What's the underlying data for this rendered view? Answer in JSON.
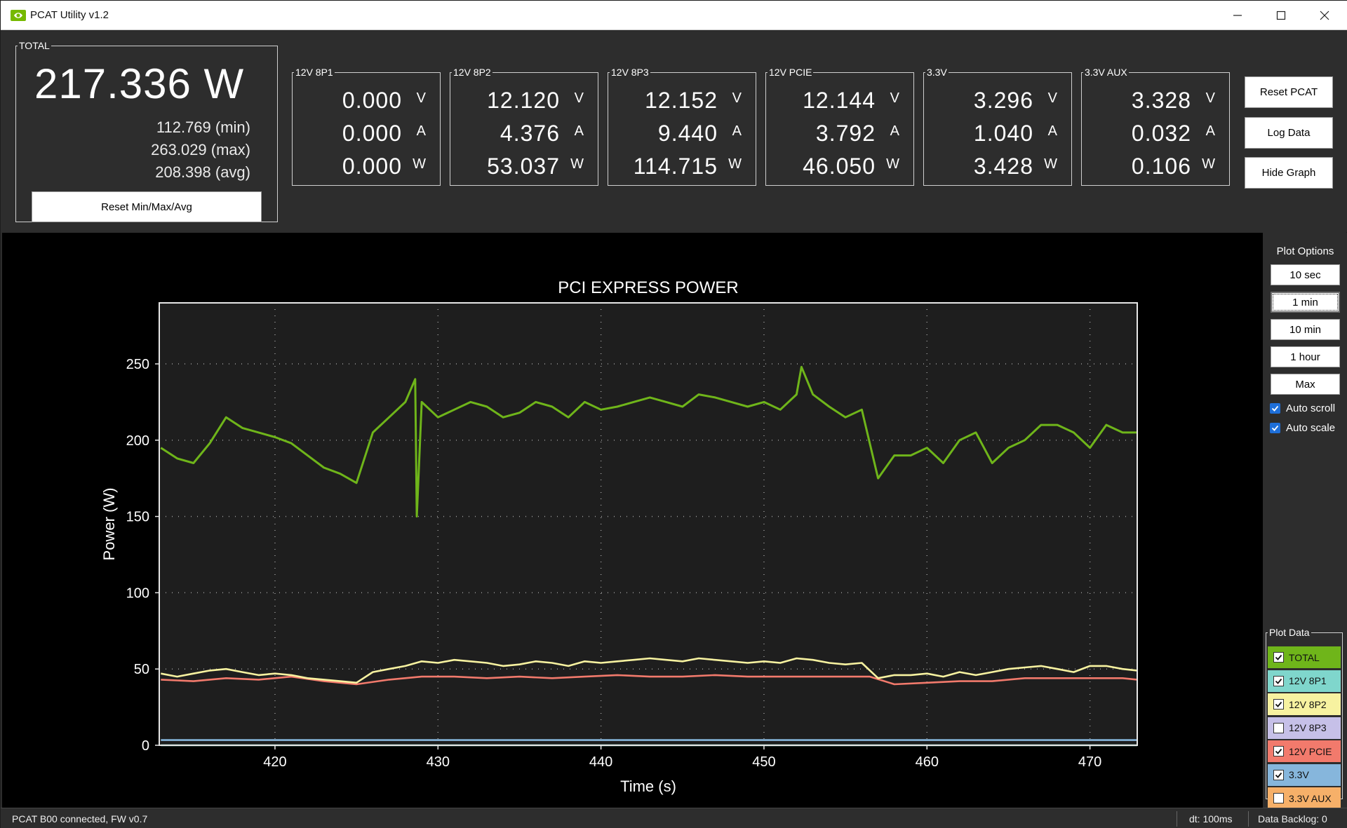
{
  "window": {
    "title": "PCAT Utility v1.2"
  },
  "total": {
    "legend": "TOTAL",
    "power": "217.336 W",
    "min": "112.769 (min)",
    "max": "263.029 (max)",
    "avg": "208.398 (avg)",
    "reset_label": "Reset Min/Max/Avg"
  },
  "rails": [
    {
      "name": "12V 8P1",
      "v": "0.000",
      "a": "0.000",
      "w": "0.000"
    },
    {
      "name": "12V 8P2",
      "v": "12.120",
      "a": "4.376",
      "w": "53.037"
    },
    {
      "name": "12V 8P3",
      "v": "12.152",
      "a": "9.440",
      "w": "114.715"
    },
    {
      "name": "12V PCIE",
      "v": "12.144",
      "a": "3.792",
      "w": "46.050"
    },
    {
      "name": "3.3V",
      "v": "3.296",
      "a": "1.040",
      "w": "3.428"
    },
    {
      "name": "3.3V AUX",
      "v": "3.328",
      "a": "0.032",
      "w": "0.106"
    }
  ],
  "units": {
    "v": "V",
    "a": "A",
    "w": "W"
  },
  "buttons": {
    "reset_pcat": "Reset PCAT",
    "log_data": "Log Data",
    "hide_graph": "Hide Graph"
  },
  "plot_options": {
    "header": "Plot Options",
    "ranges": [
      "10 sec",
      "1 min",
      "10 min",
      "1 hour",
      "Max"
    ],
    "active_range": "1 min",
    "auto_scroll": "Auto scroll",
    "auto_scale": "Auto scale",
    "auto_scroll_checked": true,
    "auto_scale_checked": true
  },
  "plot_data": {
    "header": "Plot Data",
    "items": [
      {
        "label": "TOTAL",
        "color": "#6fb51a",
        "checked": true
      },
      {
        "label": "12V 8P1",
        "color": "#7fd6cc",
        "checked": true
      },
      {
        "label": "12V 8P2",
        "color": "#f7f2a0",
        "checked": true
      },
      {
        "label": "12V 8P3",
        "color": "#c6c0e8",
        "checked": false
      },
      {
        "label": "12V PCIE",
        "color": "#f27a6c",
        "checked": true
      },
      {
        "label": "3.3V",
        "color": "#86b6dc",
        "checked": true
      },
      {
        "label": "3.3V AUX",
        "color": "#f6b069",
        "checked": false
      }
    ]
  },
  "chart_data": {
    "type": "line",
    "title": "PCI EXPRESS POWER",
    "xlabel": "Time (s)",
    "ylabel": "Power (W)",
    "xlim": [
      412.9,
      472.9
    ],
    "ylim": [
      0,
      290
    ],
    "xticks": [
      420,
      430,
      440,
      450,
      460,
      470
    ],
    "yticks": [
      0,
      50,
      100,
      150,
      200,
      250
    ],
    "grid": true,
    "series": [
      {
        "name": "TOTAL",
        "color": "#6fb51a",
        "x": [
          413,
          414,
          415,
          416,
          417,
          418,
          419,
          420,
          421,
          422,
          423,
          424,
          425,
          426,
          427,
          428,
          428.6,
          428.7,
          429,
          430,
          431,
          432,
          433,
          434,
          435,
          436,
          437,
          438,
          439,
          440,
          441,
          442,
          443,
          444,
          445,
          446,
          447,
          448,
          449,
          450,
          451,
          452,
          452.3,
          453,
          454,
          455,
          456,
          457,
          458,
          459,
          460,
          461,
          462,
          463,
          464,
          465,
          466,
          467,
          468,
          469,
          470,
          471,
          472,
          472.9
        ],
        "y": [
          195,
          188,
          185,
          198,
          215,
          208,
          205,
          202,
          198,
          190,
          182,
          178,
          172,
          205,
          215,
          225,
          240,
          150,
          225,
          215,
          220,
          225,
          222,
          215,
          218,
          225,
          222,
          215,
          225,
          220,
          222,
          225,
          228,
          225,
          222,
          230,
          228,
          225,
          222,
          225,
          220,
          230,
          248,
          230,
          222,
          215,
          220,
          175,
          190,
          190,
          195,
          185,
          200,
          205,
          185,
          195,
          200,
          210,
          210,
          205,
          195,
          210,
          205,
          205
        ]
      },
      {
        "name": "12V 8P2",
        "color": "#f7f2a0",
        "x": [
          413,
          414,
          415,
          416,
          417,
          418,
          419,
          420,
          421,
          422,
          423,
          424,
          425,
          426,
          427,
          428,
          429,
          430,
          431,
          432,
          433,
          434,
          435,
          436,
          437,
          438,
          439,
          440,
          441,
          442,
          443,
          444,
          445,
          446,
          447,
          448,
          449,
          450,
          451,
          452,
          453,
          454,
          455,
          456,
          457,
          458,
          459,
          460,
          461,
          462,
          463,
          464,
          465,
          466,
          467,
          468,
          469,
          470,
          471,
          472,
          472.9
        ],
        "y": [
          47,
          45,
          47,
          49,
          50,
          48,
          46,
          47,
          46,
          44,
          43,
          42,
          41,
          48,
          50,
          52,
          55,
          54,
          56,
          55,
          54,
          52,
          53,
          55,
          54,
          52,
          55,
          54,
          55,
          56,
          57,
          56,
          55,
          57,
          56,
          55,
          54,
          55,
          54,
          57,
          56,
          54,
          53,
          54,
          44,
          46,
          46,
          47,
          45,
          48,
          46,
          48,
          50,
          51,
          52,
          50,
          48,
          52,
          52,
          50,
          49
        ]
      },
      {
        "name": "12V PCIE",
        "color": "#f27a6c",
        "x": [
          413,
          415,
          417,
          419,
          421,
          423,
          425,
          427,
          429,
          431,
          433,
          435,
          437,
          439,
          441,
          443,
          445,
          447,
          449,
          451,
          453,
          455,
          456.5,
          458,
          460,
          462,
          464,
          466,
          468,
          470,
          472,
          472.9
        ],
        "y": [
          43,
          42,
          44,
          43,
          45,
          42,
          40,
          43,
          45,
          45,
          44,
          45,
          44,
          45,
          46,
          45,
          45,
          46,
          45,
          45,
          45,
          45,
          45,
          40,
          41,
          42,
          42,
          44,
          44,
          44,
          44,
          43
        ]
      },
      {
        "name": "3.3V",
        "color": "#86b6dc",
        "x": [
          413,
          472.9
        ],
        "y": [
          3.4,
          3.4
        ]
      },
      {
        "name": "12V 8P1",
        "color": "#7fd6cc",
        "x": [
          413,
          472.9
        ],
        "y": [
          0,
          0
        ]
      }
    ]
  },
  "status": {
    "connection": "PCAT B00 connected, FW v0.7",
    "dt": "dt: 100ms",
    "backlog": "Data Backlog: 0"
  }
}
